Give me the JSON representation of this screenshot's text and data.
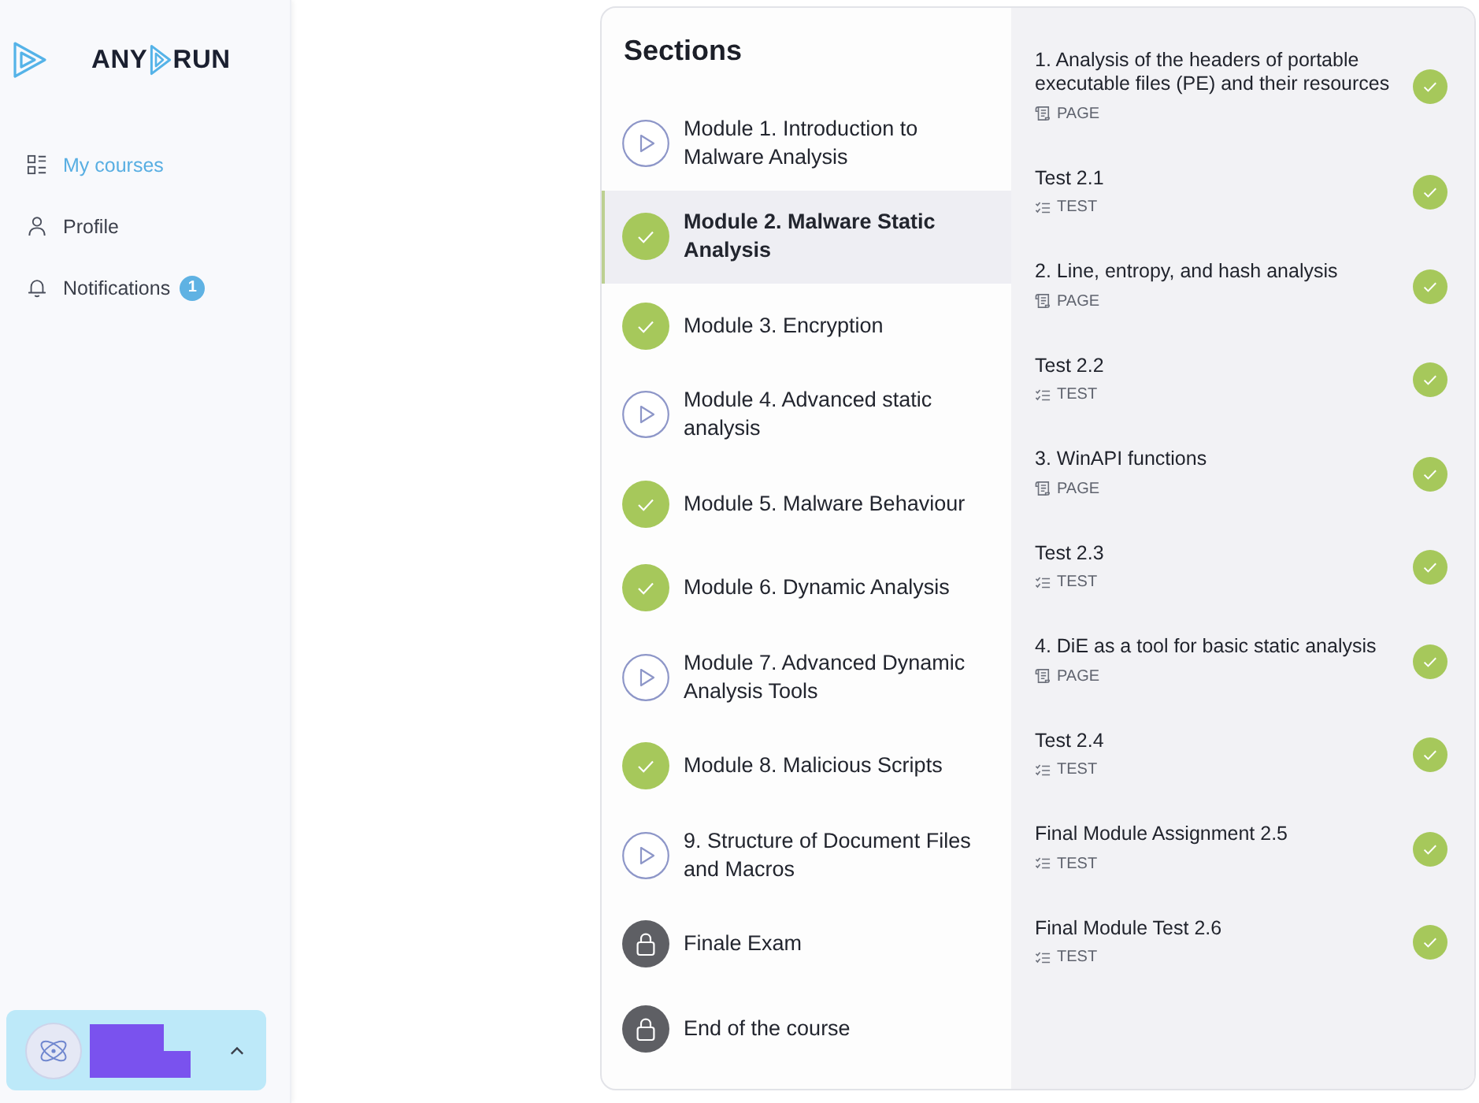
{
  "sidebar": {
    "logo": [
      "ANY",
      "RUN"
    ],
    "nav": [
      {
        "label": "My courses",
        "selected": true
      },
      {
        "label": "Profile",
        "selected": false
      },
      {
        "label": "Notifications",
        "selected": false,
        "badge": "1"
      }
    ]
  },
  "sections": {
    "title": "Sections",
    "modules": [
      {
        "title": "Module 1. Introduction to Malware Analysis",
        "kind": "open",
        "selected": false
      },
      {
        "title": "Module 2. Malware Static Analysis",
        "kind": "completed",
        "selected": true
      },
      {
        "title": "Module 3. Encryption",
        "kind": "completed",
        "selected": false
      },
      {
        "title": "Module 4. Advanced static analysis",
        "kind": "open",
        "selected": false
      },
      {
        "title": "Module 5. Malware Behaviour",
        "kind": "completed",
        "selected": false
      },
      {
        "title": "Module 6. Dynamic Analysis",
        "kind": "completed",
        "selected": false
      },
      {
        "title": "Module 7. Advanced Dynamic Analysis Tools",
        "kind": "open",
        "selected": false
      },
      {
        "title": "Module 8. Malicious Scripts",
        "kind": "completed",
        "selected": false
      },
      {
        "title": "9. Structure of Document Files and Macros",
        "kind": "open",
        "selected": false
      },
      {
        "title": "Finale Exam",
        "kind": "locked",
        "selected": false
      },
      {
        "title": "End of the course",
        "kind": "locked",
        "selected": false
      }
    ]
  },
  "lessons": [
    {
      "title": "1. Analysis of the headers of portable executable files (PE) and their resources",
      "kind": "page",
      "type_label": "PAGE",
      "completed": true
    },
    {
      "title": "Test 2.1",
      "kind": "test",
      "type_label": "TEST",
      "completed": true
    },
    {
      "title": "2. Line, entropy, and hash analysis",
      "kind": "page",
      "type_label": "PAGE",
      "completed": true
    },
    {
      "title": "Test 2.2",
      "kind": "test",
      "type_label": "TEST",
      "completed": true
    },
    {
      "title": "3. WinAPI functions",
      "kind": "page",
      "type_label": "PAGE",
      "completed": true
    },
    {
      "title": "Test 2.3",
      "kind": "test",
      "type_label": "TEST",
      "completed": true
    },
    {
      "title": "4. DiE as a tool for basic static analysis",
      "kind": "page",
      "type_label": "PAGE",
      "completed": true
    },
    {
      "title": "Test 2.4",
      "kind": "test",
      "type_label": "TEST",
      "completed": true
    },
    {
      "title": "Final Module Assignment 2.5",
      "kind": "test",
      "type_label": "TEST",
      "completed": true
    },
    {
      "title": "Final Module Test 2.6",
      "kind": "test",
      "type_label": "TEST",
      "completed": true
    }
  ]
}
